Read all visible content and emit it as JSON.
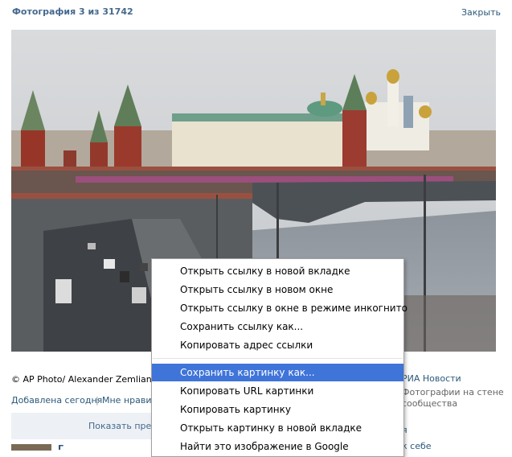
{
  "header": {
    "title": "Фотография 3 из 31742",
    "close_label": "Закрыть"
  },
  "photo": {
    "description_icon": "photo-image"
  },
  "meta": {
    "copyright": "© AP Photo/ Alexander Zemlianichenko",
    "added_label": "Добавлена сегодня",
    "separator": "|",
    "like_label": "Мне нравится",
    "comments_label": "Показать предыдущие комментарии",
    "bottom_name": "Г..."
  },
  "sidebar": {
    "album_label": "РИА Новости",
    "wall_line1": "Фотографии на стене",
    "wall_line2": "сообщества",
    "link_label": "я",
    "tome_label": "к себе"
  },
  "context_menu": {
    "items": [
      "Открыть ссылку в новой вкладке",
      "Открыть ссылку в новом окне",
      "Открыть ссылку в окне в режиме инкогнито",
      "Сохранить ссылку как...",
      "Копировать адрес ссылки",
      "Сохранить картинку как...",
      "Копировать URL картинки",
      "Копировать картинку",
      "Открыть картинку в новой вкладке",
      "Найти это изображение в Google"
    ],
    "highlighted_index": 5,
    "highlight_color": "#3f74d9"
  }
}
